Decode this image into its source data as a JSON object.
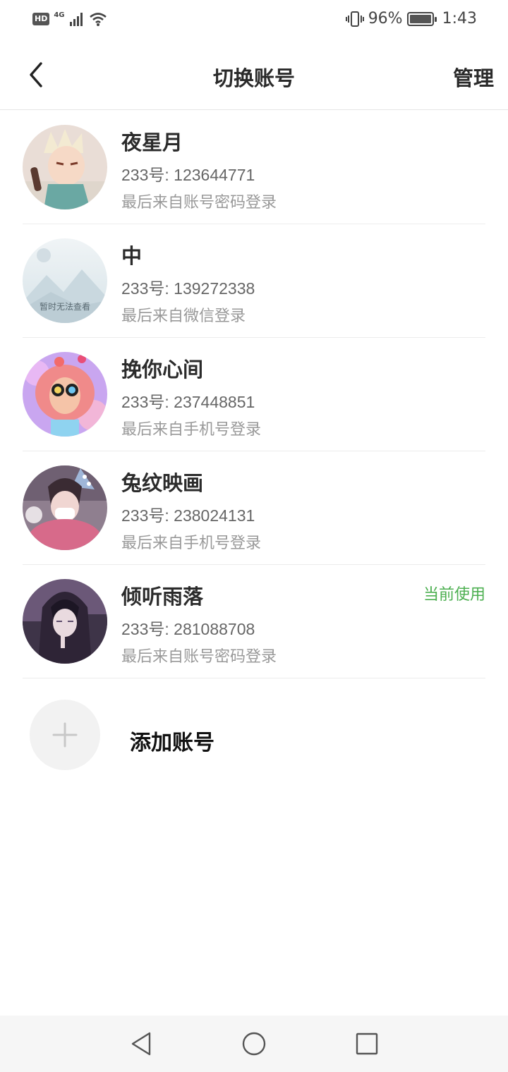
{
  "status_bar": {
    "hd": "HD",
    "network": "4G",
    "battery_percent_text": "96%",
    "battery_level": 0.96,
    "time": "1:43",
    "icons": [
      "signal-icon",
      "wifi-icon",
      "vibrate-icon",
      "battery-icon"
    ]
  },
  "header": {
    "title": "切换账号",
    "manage_label": "管理"
  },
  "accounts": [
    {
      "name": "夜星月",
      "id_text": "233号: 123644771",
      "login_source": "最后来自账号密码登录",
      "current": ""
    },
    {
      "name": "中",
      "id_text": "233号: 139272338",
      "login_source": "最后来自微信登录",
      "current": "",
      "avatar_placeholder": "暂时无法查看"
    },
    {
      "name": "挽你心间",
      "id_text": "233号: 237448851",
      "login_source": "最后来自手机号登录",
      "current": ""
    },
    {
      "name": "兔纹映画",
      "id_text": "233号: 238024131",
      "login_source": "最后来自手机号登录",
      "current": ""
    },
    {
      "name": "倾听雨落",
      "id_text": "233号: 281088708",
      "login_source": "最后来自账号密码登录",
      "current": "当前使用"
    }
  ],
  "add_account": {
    "label": "添加账号"
  },
  "colors": {
    "accent_green": "#4caf50",
    "text_primary": "#2b2b2b",
    "text_secondary": "#666666",
    "text_tertiary": "#999999"
  }
}
